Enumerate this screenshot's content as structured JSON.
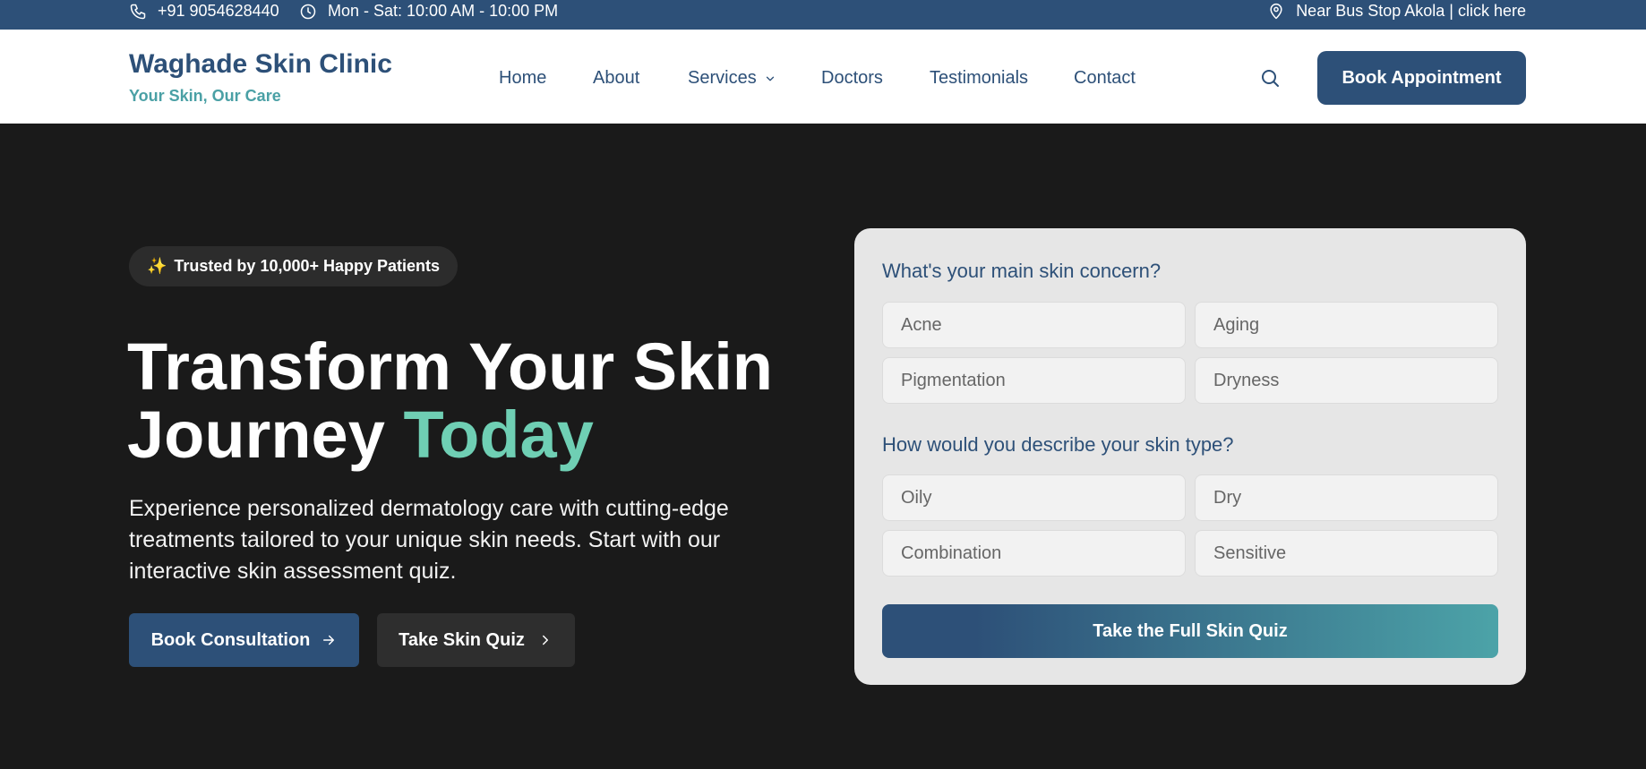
{
  "topbar": {
    "phone": "+91 9054628440",
    "hours": "Mon - Sat: 10:00 AM - 10:00 PM",
    "location": "Near Bus Stop Akola | click here"
  },
  "header": {
    "brand_name": "Waghade Skin Clinic",
    "brand_tagline": "Your Skin, Our Care",
    "nav": [
      "Home",
      "About",
      "Services",
      "Doctors",
      "Testimonials",
      "Contact"
    ],
    "book_button": "Book Appointment"
  },
  "hero": {
    "badge_icon": "✨",
    "badge_text": "Trusted by 10,000+ Happy Patients",
    "headline_line1": "Transform Your Skin",
    "headline_line2": "Journey ",
    "headline_accent": "Today",
    "description": "Experience personalized dermatology care with cutting-edge treatments tailored to your unique skin needs. Start with our interactive skin assessment quiz.",
    "primary_button": "Book Consultation",
    "secondary_button": "Take Skin Quiz"
  },
  "quiz": {
    "question1": "What's your main skin concern?",
    "concerns": [
      "Acne",
      "Aging",
      "Pigmentation",
      "Dryness"
    ],
    "question2": "How would you describe your skin type?",
    "skin_types": [
      "Oily",
      "Dry",
      "Combination",
      "Sensitive"
    ],
    "cta": "Take the Full Skin Quiz"
  },
  "colors": {
    "primary": "#2d5078",
    "accent_teal": "#4aa0a5",
    "headline_accent": "#6fcfb4",
    "hero_bg": "#1a1a1a",
    "card_bg": "#e6e6e6"
  }
}
